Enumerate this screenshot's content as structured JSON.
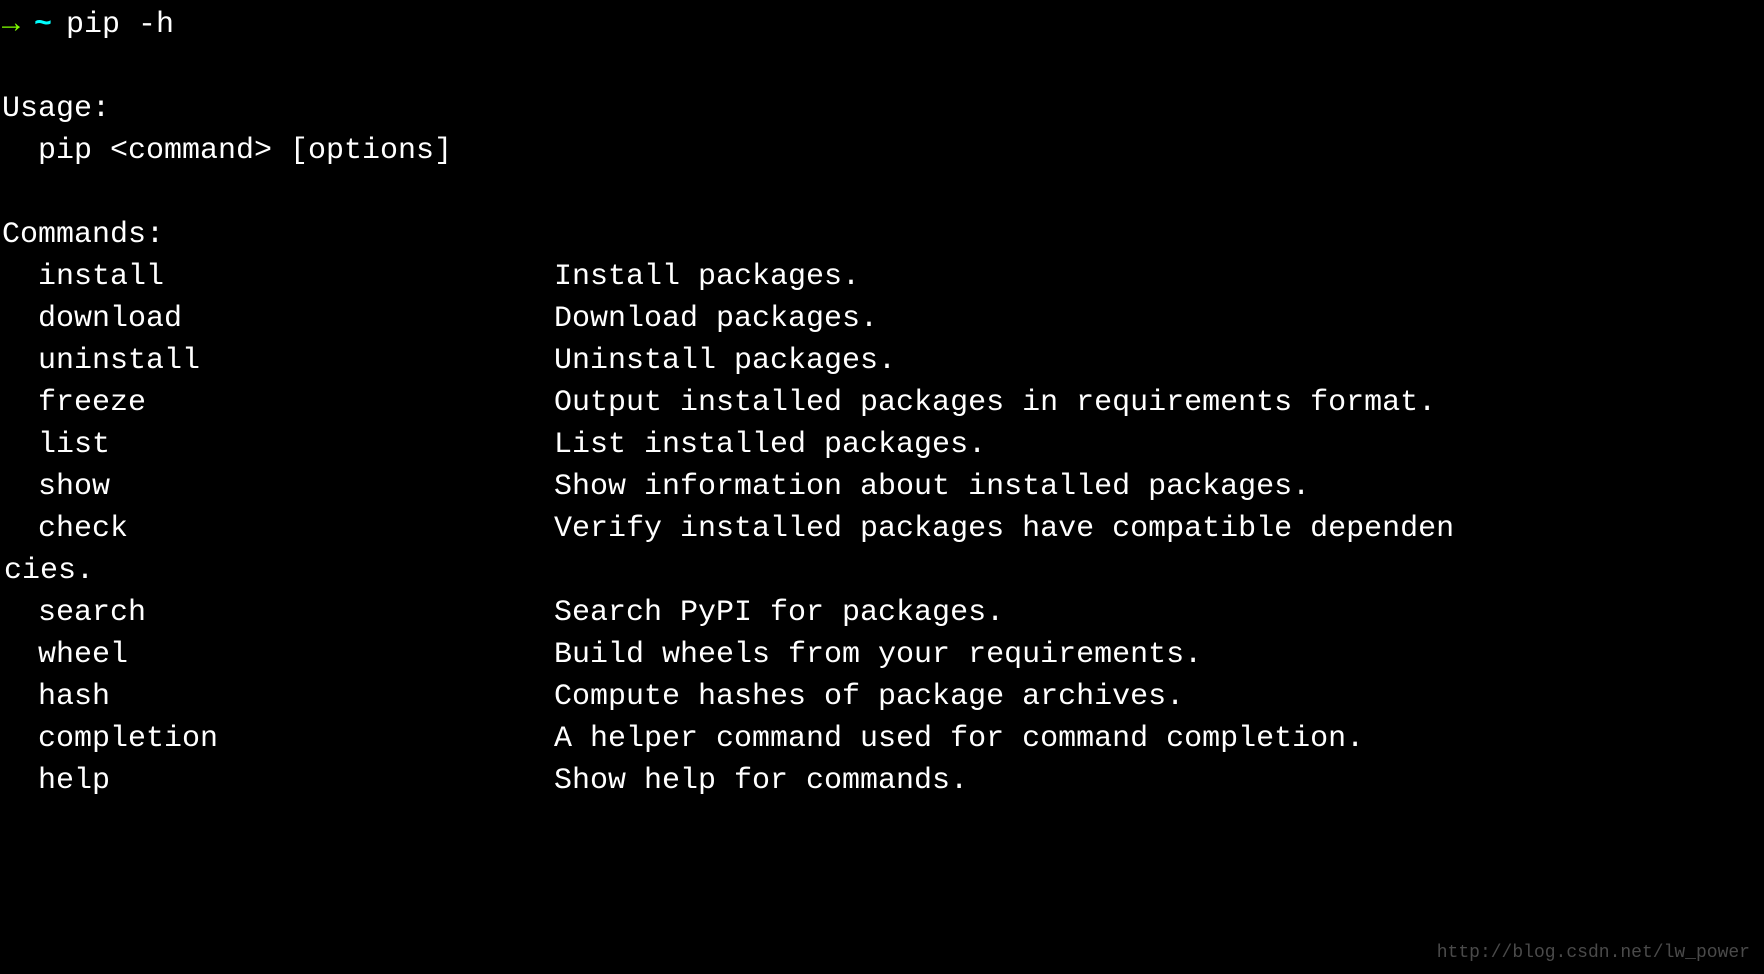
{
  "prompt": {
    "arrow": "→",
    "tilde": "~",
    "command": "pip -h"
  },
  "usage": {
    "header": "Usage:",
    "line": "pip <command> [options]"
  },
  "commands": {
    "header": "Commands:",
    "items": [
      {
        "name": "install",
        "desc": "Install packages."
      },
      {
        "name": "download",
        "desc": "Download packages."
      },
      {
        "name": "uninstall",
        "desc": "Uninstall packages."
      },
      {
        "name": "freeze",
        "desc": "Output installed packages in requirements format."
      },
      {
        "name": "list",
        "desc": "List installed packages."
      },
      {
        "name": "show",
        "desc": "Show information about installed packages."
      },
      {
        "name": "check",
        "desc": "Verify installed packages have compatible dependen",
        "overflow": "cies."
      },
      {
        "name": "search",
        "desc": "Search PyPI for packages."
      },
      {
        "name": "wheel",
        "desc": "Build wheels from your requirements."
      },
      {
        "name": "hash",
        "desc": "Compute hashes of package archives."
      },
      {
        "name": "completion",
        "desc": "A helper command used for command completion."
      },
      {
        "name": "help",
        "desc": "Show help for commands."
      }
    ]
  },
  "watermark": "http://blog.csdn.net/lw_power"
}
